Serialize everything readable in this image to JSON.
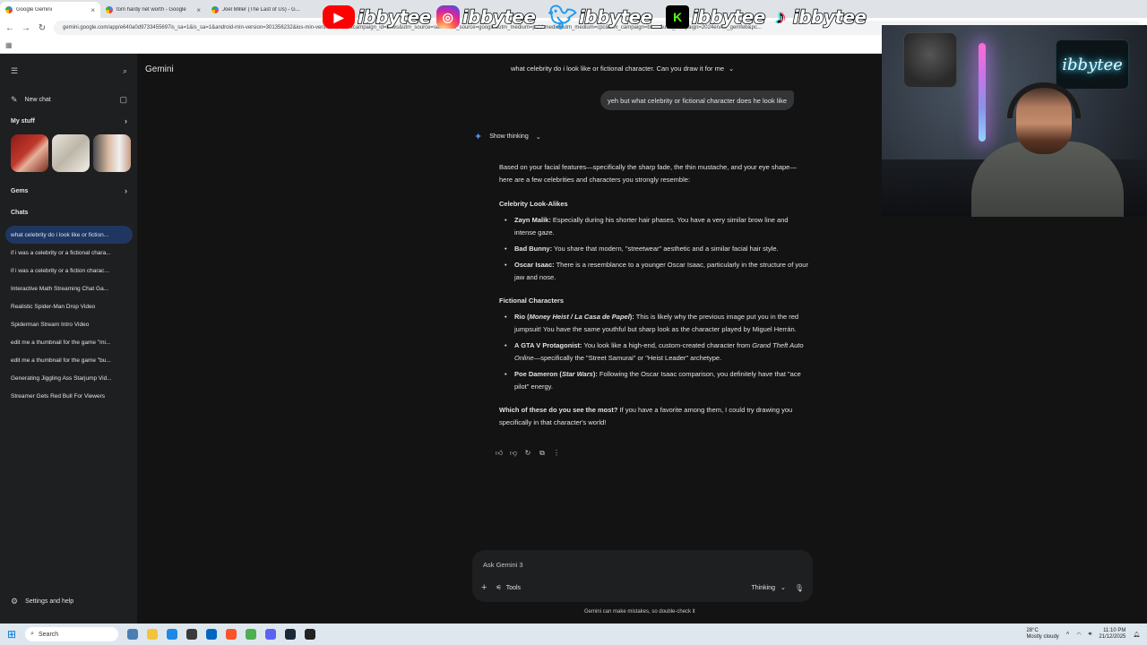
{
  "browser": {
    "tabs": [
      {
        "label": "Google Gemini",
        "active": true
      },
      {
        "label": "tom hardy net worth - Google",
        "active": false
      },
      {
        "label": "Joel Miller (The Last of Us) - G...",
        "active": false
      }
    ],
    "url": "gemini.google.com/app/e640a0d9733455697is_sa=1&is_sa=1&android-min-version=301356232&ios-min-version=322.0&campaign_id=bkws&utm_source=sem&utm_source=google&utm_medium=paid-media&utm_medium=cpc&utm_campaign=bkws&utm_campaign=2024enAU_gemfeb&pc..."
  },
  "overlay": {
    "handles": [
      {
        "platform": "youtube",
        "icon": "youtube-icon",
        "name": "ibbytee"
      },
      {
        "platform": "instagram",
        "icon": "instagram-icon",
        "name": "ibbytee_"
      },
      {
        "platform": "twitter",
        "icon": "twitter-icon",
        "name": "ibbytee_"
      },
      {
        "platform": "kick",
        "icon": "kick-icon",
        "name": "ibbytee"
      },
      {
        "platform": "tiktok",
        "icon": "tiktok-icon",
        "name": "ibbytee"
      }
    ],
    "neon_sign": "ibbytee"
  },
  "sidebar": {
    "new_chat": "New chat",
    "my_stuff": "My stuff",
    "gems": "Gems",
    "chats_heading": "Chats",
    "chats": [
      {
        "label": "what celebrity do i look like or fiction...",
        "active": true
      },
      {
        "label": "if i was a celebrity or a fictional chara...",
        "active": false
      },
      {
        "label": "if i was a celebrity or a fiction charac...",
        "active": false
      },
      {
        "label": "Interactive Math Streaming Chat Ga...",
        "active": false
      },
      {
        "label": "Realistic Spider-Man Drop Video",
        "active": false
      },
      {
        "label": "Spiderman Stream Intro Video",
        "active": false
      },
      {
        "label": "edit me a thumbnail for the game \"mi...",
        "active": false
      },
      {
        "label": "edit me a thumbnail for the game \"bu...",
        "active": false
      },
      {
        "label": "Generating Jiggling Ass Starjump Vid...",
        "active": false
      },
      {
        "label": "Streamer Gets Red Bull For Viewers",
        "active": false
      }
    ],
    "settings": "Settings and help"
  },
  "header": {
    "brand": "Gemini",
    "conversation_title": "what celebrity do i look like or fictional character. Can you draw it for me"
  },
  "conversation": {
    "user_message": "yeh but what celebrity or fictional character does he look like",
    "show_thinking": "Show thinking",
    "intro": "Based on your facial features—specifically the sharp fade, the thin mustache, and your eye shape—here are a few celebrities and characters you strongly resemble:",
    "celebrity_heading": "Celebrity Look-Alikes",
    "celebrities": [
      {
        "name": "Zayn Malik:",
        "text": " Especially during his shorter hair phases. You have a very similar brow line and intense gaze."
      },
      {
        "name": "Bad Bunny:",
        "text": " You share that modern, \"streetwear\" aesthetic and a similar facial hair style."
      },
      {
        "name": "Oscar Isaac:",
        "text": " There is a resemblance to a younger Oscar Isaac, particularly in the structure of your jaw and nose."
      }
    ],
    "fictional_heading": "Fictional Characters",
    "rio_name": "Rio (",
    "rio_show": "Money Heist / La Casa de Papel",
    "rio_close": "):",
    "rio_text": " This is likely why the previous image put you in the red jumpsuit! You have the same youthful but sharp look as the character played by Miguel Herrán.",
    "gta_name": "A GTA V Protagonist:",
    "gta_text1": " You look like a high-end, custom-created character from ",
    "gta_game": "Grand Theft Auto Online",
    "gta_text2": "—specifically the \"Street Samurai\" or \"Heist Leader\" archetype.",
    "poe_name": "Poe Dameron (",
    "poe_show": "Star Wars",
    "poe_close": "):",
    "poe_text": " Following the Oscar Isaac comparison, you definitely have that \"ace pilot\" energy.",
    "closing_bold": "Which of these do you see the most?",
    "closing_text": " If you have a favorite among them, I could try drawing you specifically in that character's world!"
  },
  "input": {
    "placeholder": "Ask Gemini 3",
    "tools": "Tools",
    "mode": "Thinking",
    "disclaimer": "Gemini can make mistakes, so double-check it"
  },
  "taskbar": {
    "search": "Search",
    "weather_temp": "28°C",
    "weather_desc": "Mostly cloudy",
    "time": "11:10 PM",
    "date": "21/12/2025"
  },
  "colors": {
    "app_bg": "#131314",
    "sidebar_bg": "#1e1f20",
    "active_chat": "#1f3760",
    "accent_spark": "#4c8df6"
  }
}
